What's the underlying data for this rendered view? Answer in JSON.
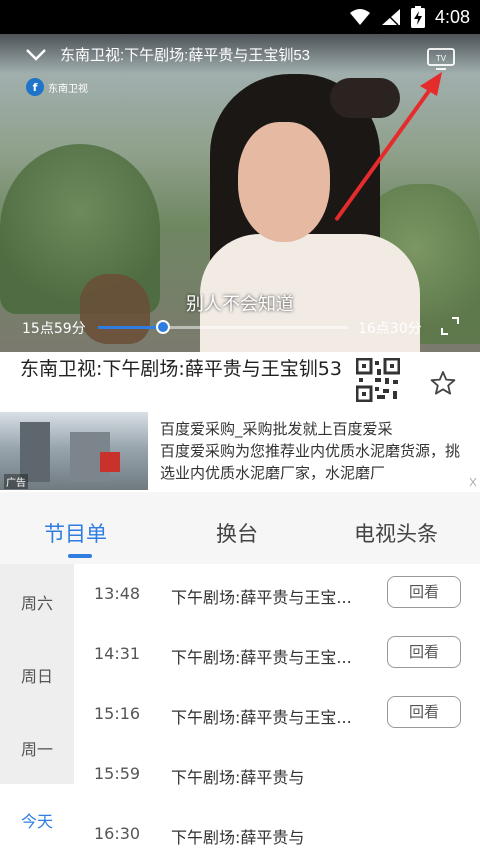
{
  "status_bar": {
    "time": "4:08",
    "icons": [
      "wifi-icon",
      "signal-icon",
      "battery-charging-icon"
    ]
  },
  "player": {
    "title": "东南卫视:下午剧场:薛平贵与王宝钏53",
    "channel_logo_text": "东南卫视",
    "subtitle": "别人不会知道",
    "time_start": "15点59分",
    "time_end": "16点30分",
    "progress": 0.26,
    "tv_label": "TV",
    "accent": "#2f7de1"
  },
  "program": {
    "title": "东南卫视:下午剧场:薛平贵与王宝钏53"
  },
  "ad": {
    "title": "百度爱采购_采购批发就上百度爱采",
    "desc": "百度爱采购为您推荐业内优质水泥磨货源，挑选业内优质水泥磨厂家，水泥磨厂",
    "badge": "广告"
  },
  "tabs": [
    {
      "label": "节目单",
      "active": true
    },
    {
      "label": "换台",
      "active": false
    },
    {
      "label": "电视头条",
      "active": false
    }
  ],
  "days": [
    {
      "label": "周六",
      "active": false
    },
    {
      "label": "周日",
      "active": false
    },
    {
      "label": "周一",
      "active": false
    },
    {
      "label": "今天",
      "active": true
    }
  ],
  "schedule": [
    {
      "time": "13:48",
      "name": "下午剧场:薛平贵与王宝...",
      "button": "回看"
    },
    {
      "time": "14:31",
      "name": "下午剧场:薛平贵与王宝...",
      "button": "回看"
    },
    {
      "time": "15:16",
      "name": "下午剧场:薛平贵与王宝...",
      "button": "回看"
    },
    {
      "time": "15:59",
      "name": "下午剧场:薛平贵与",
      "button": ""
    },
    {
      "time": "16:30",
      "name": "下午剧场:薛平贵与",
      "button": ""
    }
  ]
}
